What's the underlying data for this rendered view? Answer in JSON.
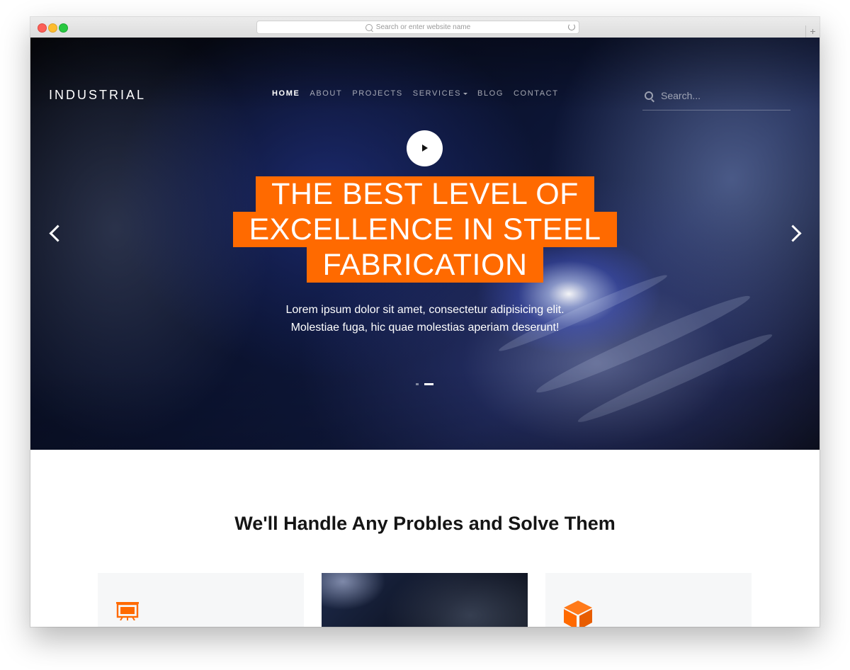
{
  "browser": {
    "url_placeholder": "Search or enter website name",
    "new_tab_label": "+"
  },
  "brand": "INDUSTRIAL",
  "nav": {
    "items": [
      {
        "label": "HOME",
        "active": true
      },
      {
        "label": "ABOUT",
        "active": false
      },
      {
        "label": "PROJECTS",
        "active": false
      },
      {
        "label": "SERVICES",
        "active": false,
        "dropdown": true
      },
      {
        "label": "BLOG",
        "active": false
      },
      {
        "label": "CONTACT",
        "active": false
      }
    ]
  },
  "search": {
    "placeholder": "Search..."
  },
  "hero": {
    "headline_lines": [
      "THE BEST LEVEL OF",
      "EXCELLENCE IN STEEL",
      "FABRICATION"
    ],
    "text": "Lorem ipsum dolor sit amet, consectetur adipisicing elit. Molestiae fuga, hic quae molestias aperiam deserunt!",
    "slide_count": 2,
    "active_slide": 2
  },
  "section": {
    "title": "We'll Handle Any Probles and Solve Them"
  },
  "cards": [
    {
      "icon": "easel-icon"
    },
    {
      "icon": "image"
    },
    {
      "icon": "cube-icon"
    }
  ],
  "colors": {
    "accent": "#ff6a00",
    "text_dark": "#151515",
    "card_bg": "#f6f7f8"
  }
}
